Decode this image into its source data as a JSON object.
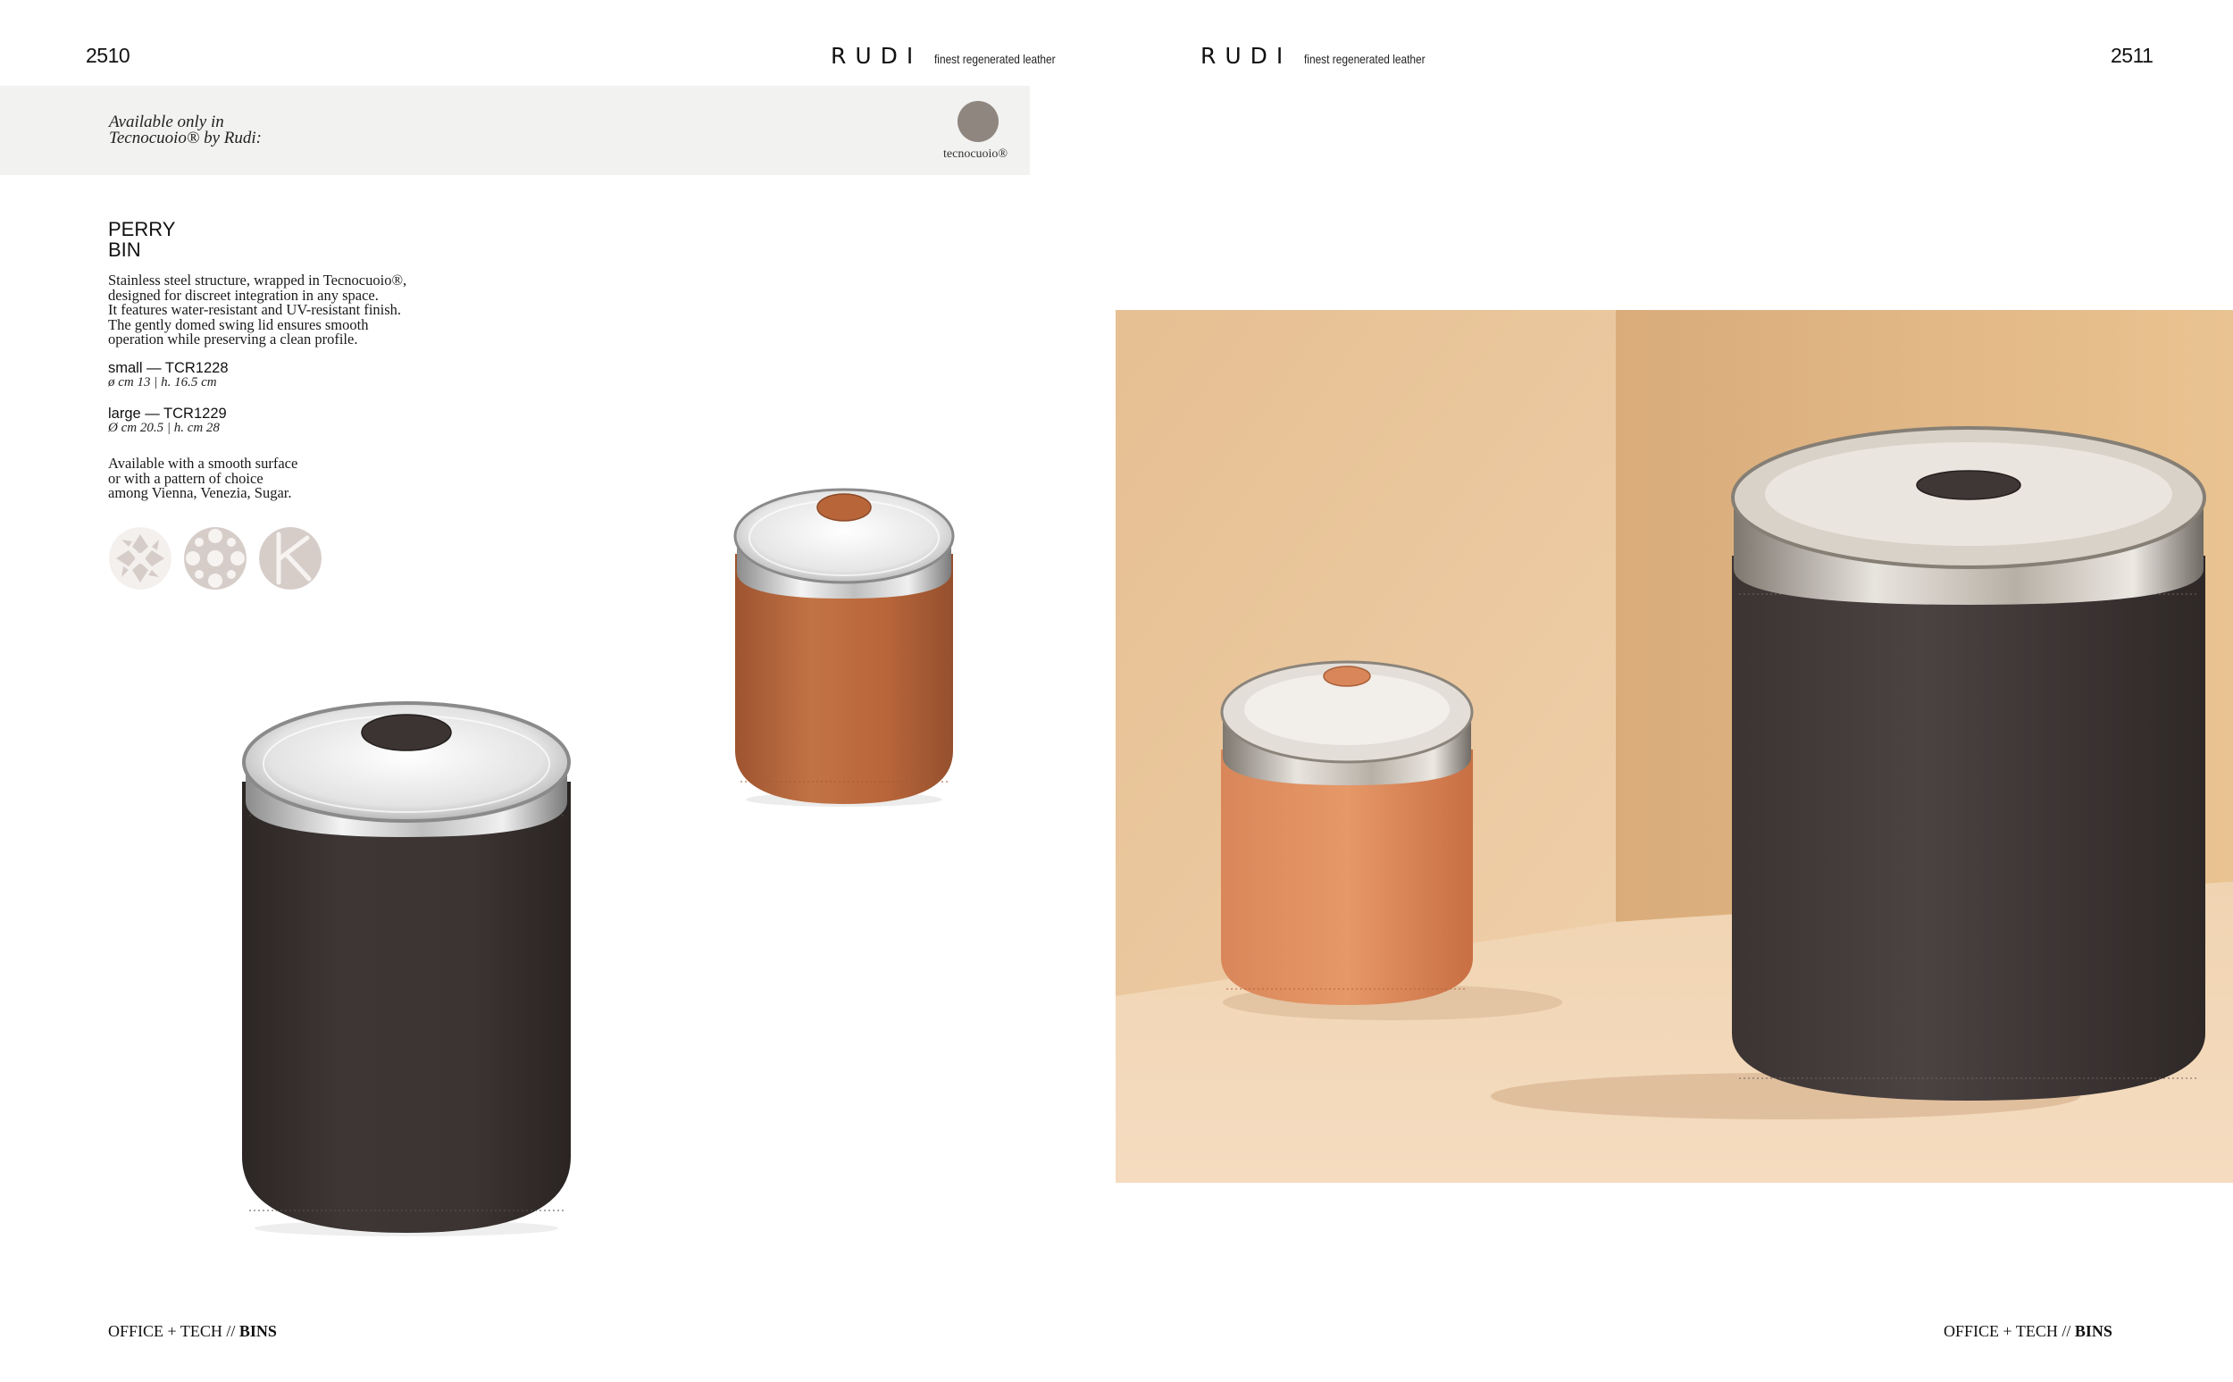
{
  "left_page": {
    "page_number": "2510",
    "brand": {
      "name": "RUDI",
      "tagline": "finest regenerated leather"
    },
    "banner": {
      "line1": "Available only in",
      "line2": "Tecnocuoio® by Rudi:",
      "swatch_label": "tecnocuoio®",
      "swatch_color": "#8f8680"
    },
    "product": {
      "title_line1": "PERRY",
      "title_line2": "BIN",
      "description": [
        "Stainless steel structure, wrapped in Tecnocuoio®,",
        "designed for discreet integration in any space.",
        "It features water-resistant and UV-resistant finish.",
        "The gently domed swing lid ensures smooth",
        "operation while preserving a clean profile."
      ],
      "variants": [
        {
          "label": "small — TCR1228",
          "dims": "ø cm 13 | h. 16.5 cm"
        },
        {
          "label": "large — TCR1229",
          "dims": "Ø cm 20.5 | h. cm 28"
        }
      ],
      "availability": [
        "Available with a smooth surface",
        "or with a pattern of choice",
        "among Vienna, Venezia, Sugar."
      ],
      "patterns": [
        "vienna-pattern-icon",
        "venezia-pattern-icon",
        "sugar-pattern-icon"
      ]
    },
    "footer": {
      "section": "OFFICE + TECH //",
      "category": "BINS"
    }
  },
  "right_page": {
    "page_number": "2511",
    "brand": {
      "name": "RUDI",
      "tagline": "finest regenerated leather"
    },
    "footer": {
      "section": "OFFICE + TECH //",
      "category": "BINS"
    }
  },
  "colors": {
    "leather_dark": "#3b3432",
    "leather_tan": "#b8653a",
    "backdrop": "#ecc9a0",
    "pattern_grey": "#d6cdc9"
  }
}
